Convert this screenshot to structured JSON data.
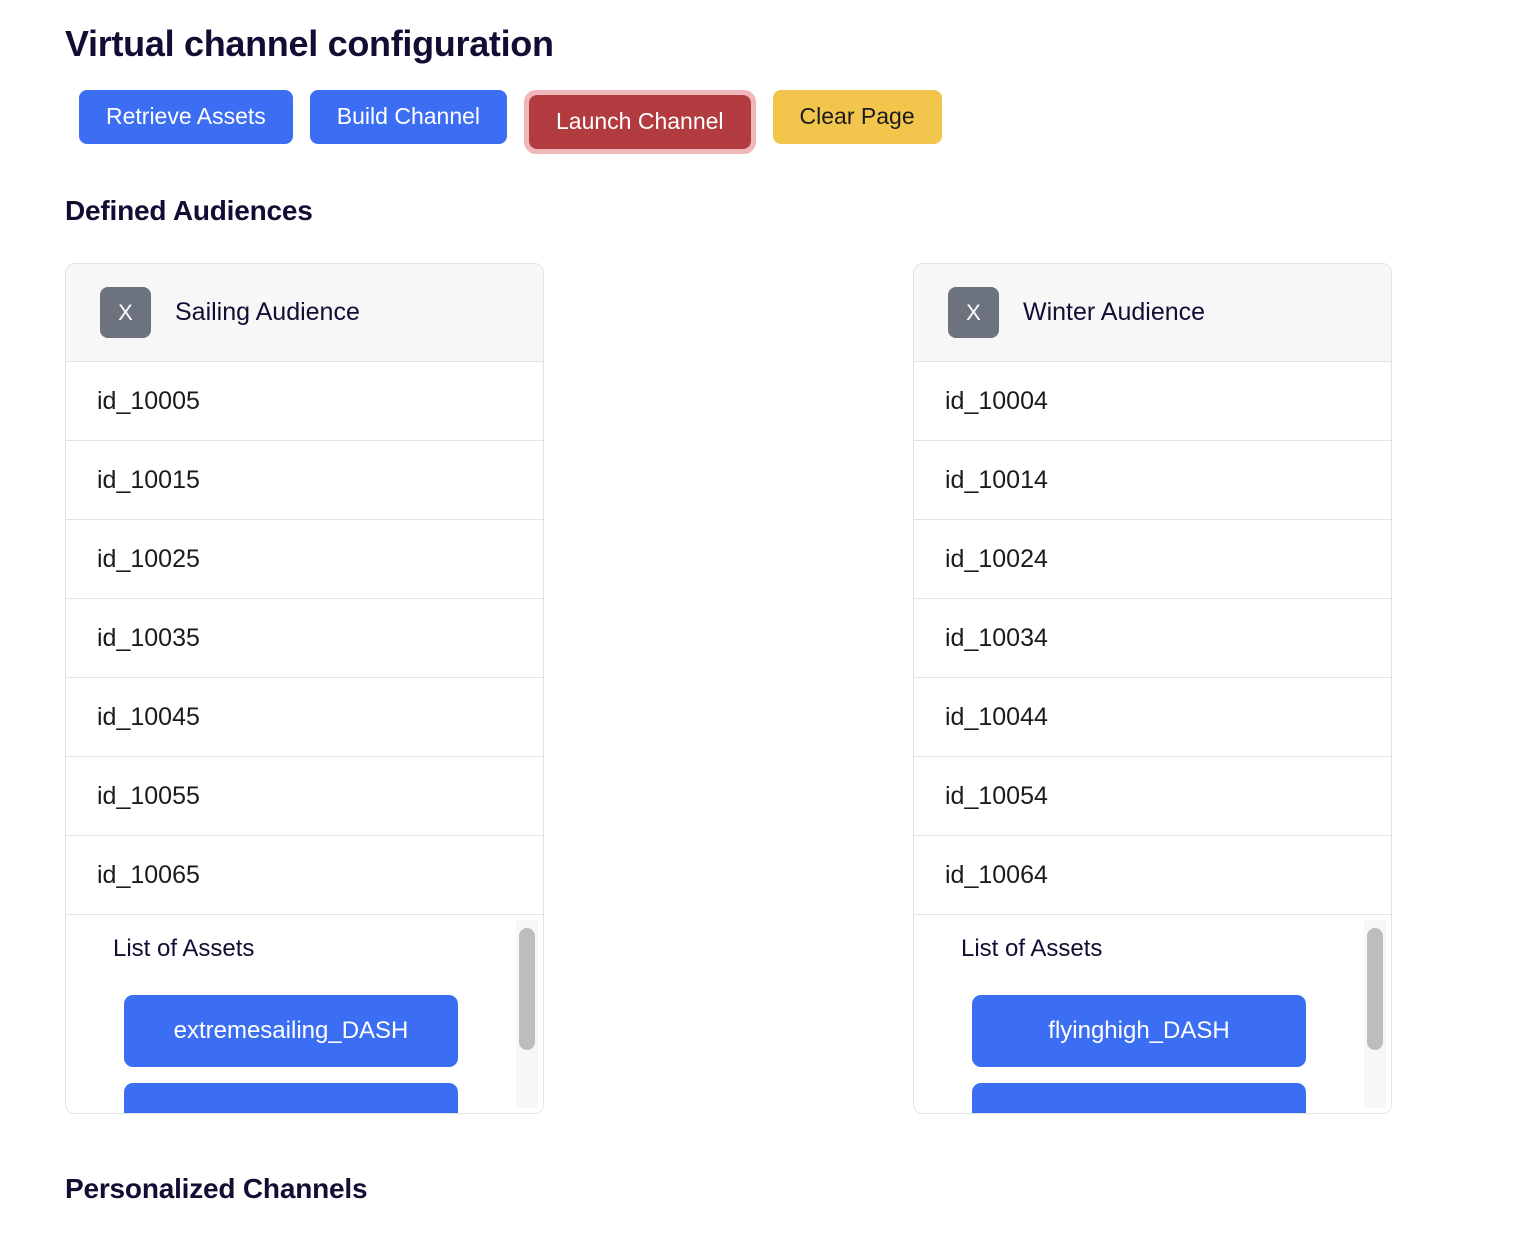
{
  "page_title": "Virtual channel configuration",
  "toolbar": {
    "buttons": [
      {
        "label": "Retrieve Assets",
        "style": "blue"
      },
      {
        "label": "Build Channel",
        "style": "blue"
      },
      {
        "label": "Launch Channel",
        "style": "red",
        "focused": true
      },
      {
        "label": "Clear Page",
        "style": "yellow"
      }
    ]
  },
  "sections": {
    "defined_audiences": "Defined Audiences",
    "personalized_channels": "Personalized Channels"
  },
  "colors": {
    "blue": "#3b6ef3",
    "red": "#b23b3f",
    "yellow": "#f2c64c",
    "focus_ring": "#f0b7bb",
    "remove_button": "#6c737f",
    "heading": "#110d33",
    "card_border": "#e1e3e6",
    "card_header_bg": "#f7f7f8"
  },
  "audiences": [
    {
      "name": "Sailing Audience",
      "remove_label": "X",
      "ids": [
        "id_10005",
        "id_10015",
        "id_10025",
        "id_10035",
        "id_10045",
        "id_10055",
        "id_10065"
      ],
      "assets_title": "List of Assets",
      "assets": [
        "extremesailing_DASH",
        ""
      ]
    },
    {
      "name": "Winter Audience",
      "remove_label": "X",
      "ids": [
        "id_10004",
        "id_10014",
        "id_10024",
        "id_10034",
        "id_10044",
        "id_10054",
        "id_10064"
      ],
      "assets_title": "List of Assets",
      "assets": [
        "flyinghigh_DASH",
        ""
      ]
    }
  ]
}
